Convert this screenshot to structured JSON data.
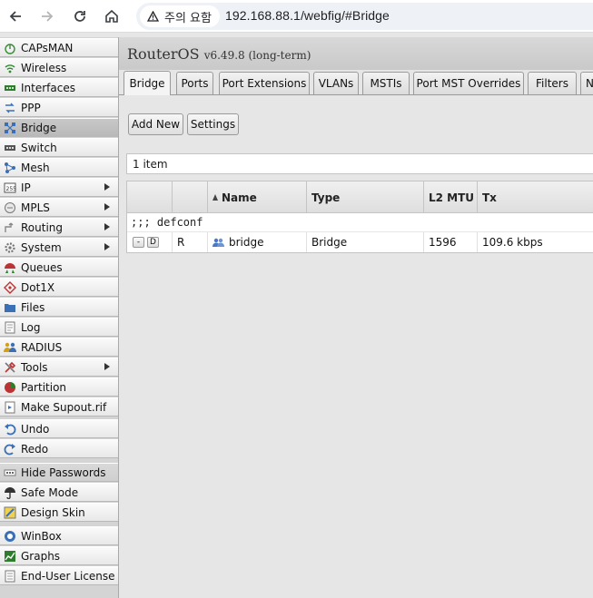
{
  "browser": {
    "security_label": "주의 요함",
    "url": "192.168.88.1/webfig/#Bridge"
  },
  "sidebar": {
    "items": [
      {
        "label": "CAPsMAN",
        "icon": "capsman-icon",
        "arrow": false
      },
      {
        "label": "Wireless",
        "icon": "wireless-icon",
        "arrow": false
      },
      {
        "label": "Interfaces",
        "icon": "interfaces-icon",
        "arrow": false
      },
      {
        "label": "PPP",
        "icon": "ppp-icon",
        "arrow": false
      },
      {
        "label": "Bridge",
        "icon": "bridge-icon",
        "arrow": false,
        "selected": true
      },
      {
        "label": "Switch",
        "icon": "switch-icon",
        "arrow": false
      },
      {
        "label": "Mesh",
        "icon": "mesh-icon",
        "arrow": false
      },
      {
        "label": "IP",
        "icon": "ip-icon",
        "arrow": true
      },
      {
        "label": "MPLS",
        "icon": "mpls-icon",
        "arrow": true
      },
      {
        "label": "Routing",
        "icon": "routing-icon",
        "arrow": true
      },
      {
        "label": "System",
        "icon": "system-icon",
        "arrow": true
      },
      {
        "label": "Queues",
        "icon": "queues-icon",
        "arrow": false
      },
      {
        "label": "Dot1X",
        "icon": "dot1x-icon",
        "arrow": false
      },
      {
        "label": "Files",
        "icon": "files-icon",
        "arrow": false
      },
      {
        "label": "Log",
        "icon": "log-icon",
        "arrow": false
      },
      {
        "label": "RADIUS",
        "icon": "radius-icon",
        "arrow": false
      },
      {
        "label": "Tools",
        "icon": "tools-icon",
        "arrow": true
      },
      {
        "label": "Partition",
        "icon": "partition-icon",
        "arrow": false
      },
      {
        "label": "Make Supout.rif",
        "icon": "supout-icon",
        "arrow": false
      }
    ],
    "history_items": [
      {
        "label": "Undo",
        "icon": "undo-icon"
      },
      {
        "label": "Redo",
        "icon": "redo-icon"
      }
    ],
    "option_items": [
      {
        "label": "Hide Passwords",
        "icon": "hide-passwords-icon"
      },
      {
        "label": "Safe Mode",
        "icon": "safe-mode-icon"
      },
      {
        "label": "Design Skin",
        "icon": "design-skin-icon"
      }
    ],
    "link_items": [
      {
        "label": "WinBox",
        "icon": "winbox-icon"
      },
      {
        "label": "Graphs",
        "icon": "graphs-icon"
      },
      {
        "label": "End-User License",
        "icon": "license-icon"
      }
    ]
  },
  "header": {
    "title": "RouterOS",
    "version": "v6.49.8 (long-term)"
  },
  "tabs": [
    "Bridge",
    "Ports",
    "Port Extensions",
    "VLANs",
    "MSTIs",
    "Port MST Overrides",
    "Filters",
    "NAT"
  ],
  "toolbar": {
    "add_new": "Add New",
    "settings": "Settings"
  },
  "list": {
    "count": "1 item",
    "columns": [
      "Name",
      "Type",
      "L2 MTU",
      "Tx"
    ],
    "comment": ";;; defconf",
    "row": {
      "btn_remove": "-",
      "btn_disable": "D",
      "flag": "R",
      "name": "bridge",
      "type": "Bridge",
      "l2mtu": "1596",
      "tx": "109.6 kbps"
    }
  }
}
